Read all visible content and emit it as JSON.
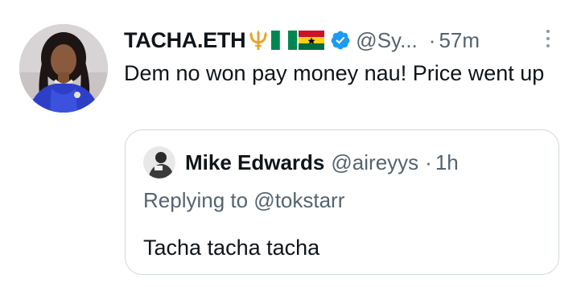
{
  "tweet": {
    "display_name": "TACHA.ETH",
    "emojis": [
      "trident-emoji",
      "nigeria-flag-emoji",
      "ghana-flag-emoji"
    ],
    "verified": true,
    "handle": "@Sy...",
    "separator": "·",
    "time": "57m",
    "text": "Dem no won pay money nau! Price went up"
  },
  "quoted_tweet": {
    "display_name": "Mike Edwards",
    "handle": "@aireyys",
    "separator": "·",
    "time": "1h",
    "reply_context": "Replying to @tokstarr",
    "text": "Tacha tacha tacha"
  },
  "colors": {
    "text": "#0f1419",
    "secondary": "#536471",
    "verified_blue": "#1d9bf0",
    "border": "#cfd9de",
    "trident_gold": "#e8a52c",
    "nigeria_green": "#008751",
    "ghana_red": "#ce1126",
    "ghana_yellow": "#fcd116",
    "ghana_green": "#006b3f"
  }
}
